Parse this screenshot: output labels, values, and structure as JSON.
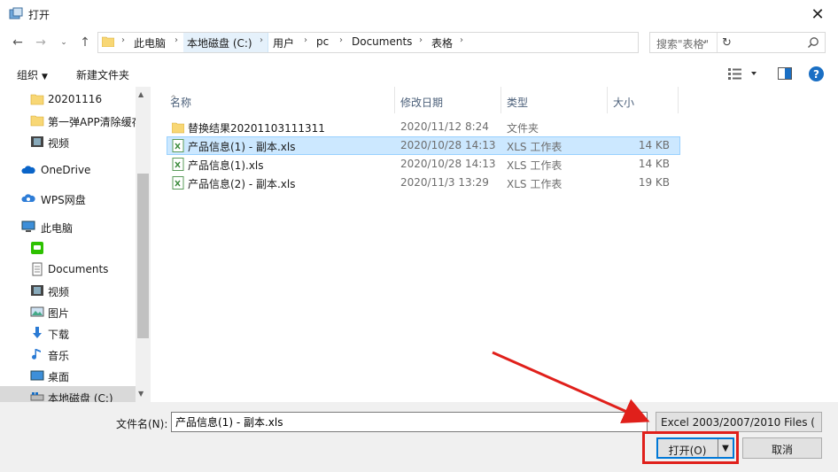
{
  "window": {
    "title": "打开"
  },
  "address": {
    "crumbs": [
      "此电脑",
      "本地磁盘 (C:)",
      "用户",
      "pc",
      "Documents",
      "表格"
    ],
    "search_placeholder": "搜索\"表格\""
  },
  "toolbar": {
    "organize": "组织",
    "new_folder": "新建文件夹"
  },
  "nav": [
    {
      "label": "20201116",
      "icon": "folder-icon"
    },
    {
      "label": "第一弹APP清除缓存",
      "icon": "folder-icon"
    },
    {
      "label": "视频",
      "icon": "video-icon"
    },
    {
      "label": "OneDrive",
      "icon": "cloud-icon"
    },
    {
      "label": "WPS网盘",
      "icon": "wps-cloud-icon"
    },
    {
      "label": "此电脑",
      "icon": "computer-icon"
    },
    {
      "label": "",
      "icon": "wechat-icon"
    },
    {
      "label": "Documents",
      "icon": "documents-icon"
    },
    {
      "label": "视频",
      "icon": "video-icon"
    },
    {
      "label": "图片",
      "icon": "picture-icon"
    },
    {
      "label": "下载",
      "icon": "download-icon"
    },
    {
      "label": "音乐",
      "icon": "music-icon"
    },
    {
      "label": "桌面",
      "icon": "desktop-icon"
    },
    {
      "label": "本地磁盘 (C:)",
      "icon": "disk-icon"
    }
  ],
  "columns": {
    "name": "名称",
    "modified": "修改日期",
    "type": "类型",
    "size": "大小"
  },
  "files": [
    {
      "name": "替换结果20201103111311",
      "modified": "2020/11/12 8:24",
      "type": "文件夹",
      "size": ""
    },
    {
      "name": "产品信息(1) - 副本.xls",
      "modified": "2020/10/28 14:13",
      "type": "XLS 工作表",
      "size": "14 KB"
    },
    {
      "name": "产品信息(1).xls",
      "modified": "2020/10/28 14:13",
      "type": "XLS 工作表",
      "size": "14 KB"
    },
    {
      "name": "产品信息(2) - 副本.xls",
      "modified": "2020/11/3 13:29",
      "type": "XLS 工作表",
      "size": "19 KB"
    }
  ],
  "bottom": {
    "filename_label": "文件名(N):",
    "filename_value": "产品信息(1) - 副本.xls",
    "filetype": "Excel 2003/2007/2010 Files (",
    "open": "打开(O)",
    "cancel": "取消"
  },
  "colors": {
    "accent": "#0078d7",
    "selection": "#cce8ff",
    "annotation": "#e0201b",
    "folder": "#f8d775"
  }
}
